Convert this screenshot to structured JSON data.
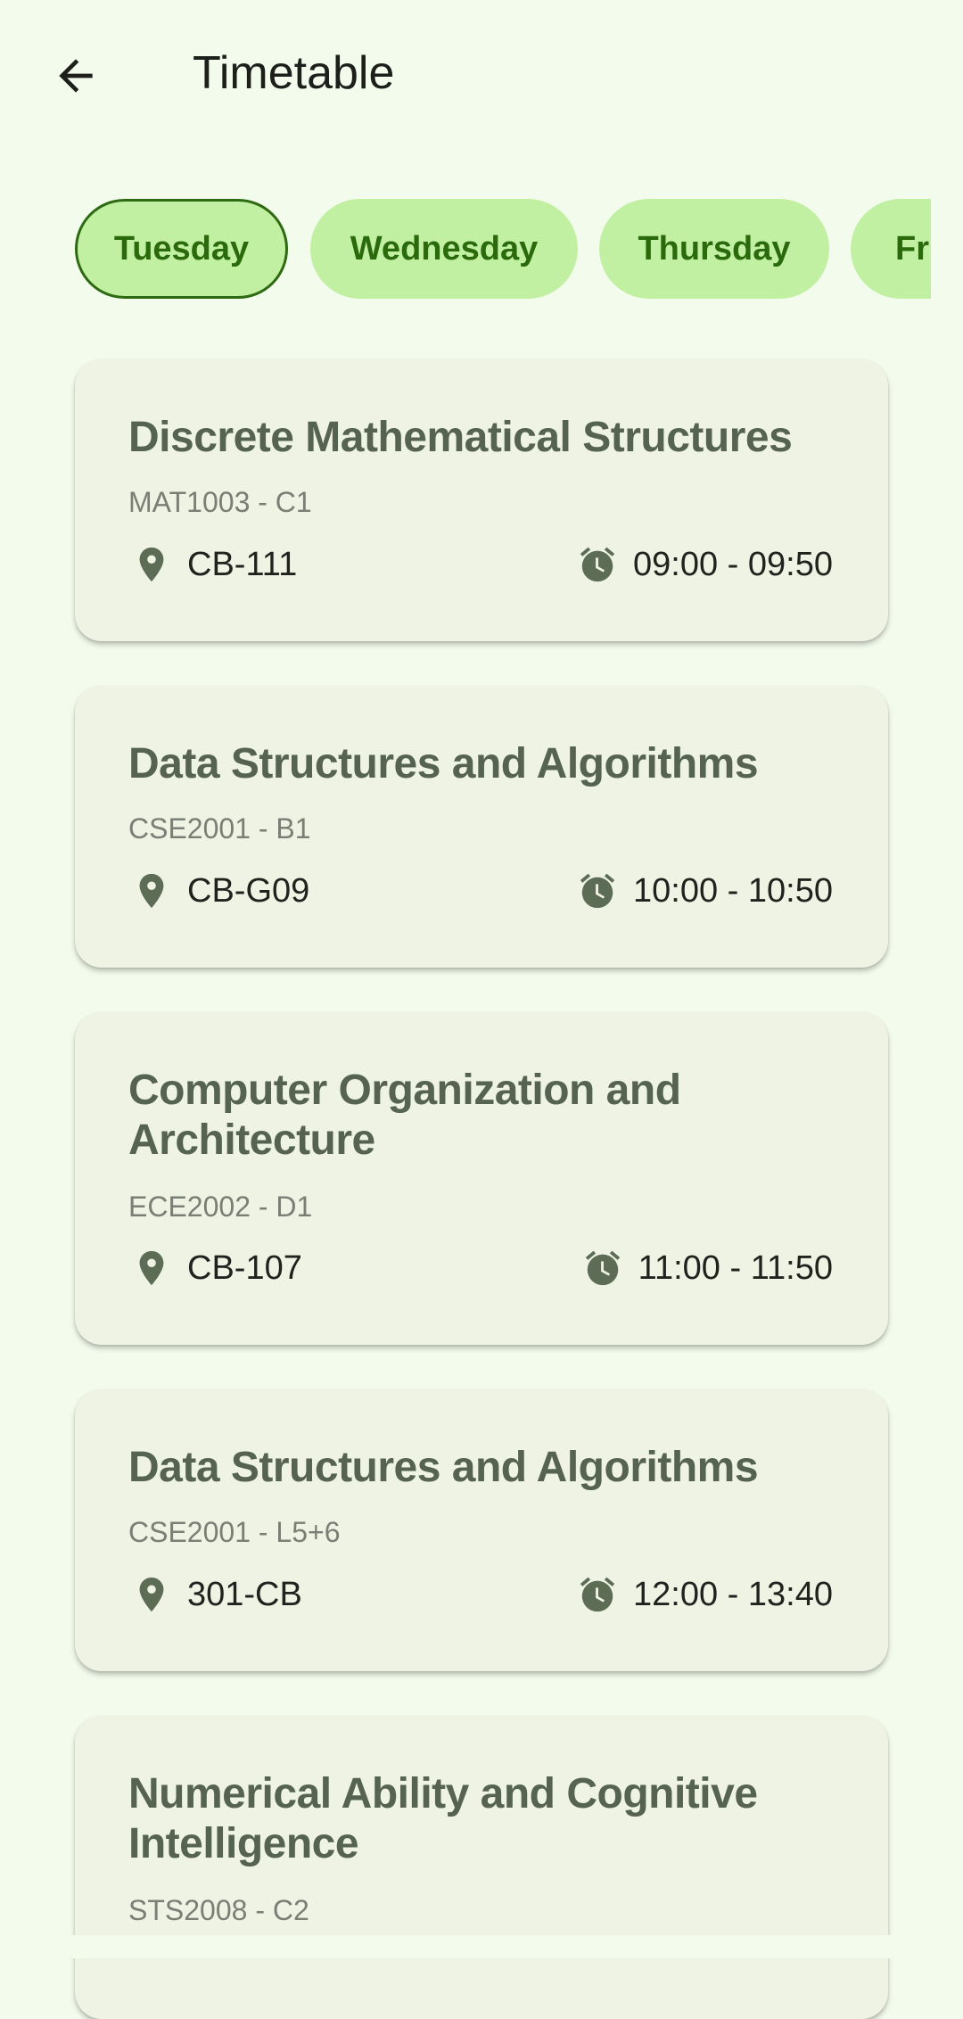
{
  "header": {
    "title": "Timetable"
  },
  "days": [
    "Tuesday",
    "Wednesday",
    "Thursday",
    "Friday"
  ],
  "selected_day": "Tuesday",
  "classes": [
    {
      "title": "Discrete Mathematical Structures",
      "code": "MAT1003 - C1",
      "room": "CB-111",
      "time": "09:00 - 09:50"
    },
    {
      "title": "Data Structures and Algorithms",
      "code": "CSE2001 - B1",
      "room": "CB-G09",
      "time": "10:00 - 10:50"
    },
    {
      "title": "Computer Organization and Architecture",
      "code": "ECE2002 - D1",
      "room": "CB-107",
      "time": "11:00 - 11:50"
    },
    {
      "title": "Data Structures and Algorithms",
      "code": "CSE2001 - L5+6",
      "room": "301-CB",
      "time": "12:00 - 13:40"
    },
    {
      "title": "Numerical Ability and Cognitive Intelligence",
      "code": "STS2008 - C2",
      "room": "",
      "time": ""
    }
  ],
  "colors": {
    "background": "#f2fbec",
    "chip": "#c2f0a2",
    "chip_text": "#2b6a0c",
    "card": "#eff3e4",
    "icon": "#5d6c55"
  },
  "icons": {
    "back": "arrow-back-icon",
    "room": "location-pin-icon",
    "time": "alarm-clock-icon"
  }
}
